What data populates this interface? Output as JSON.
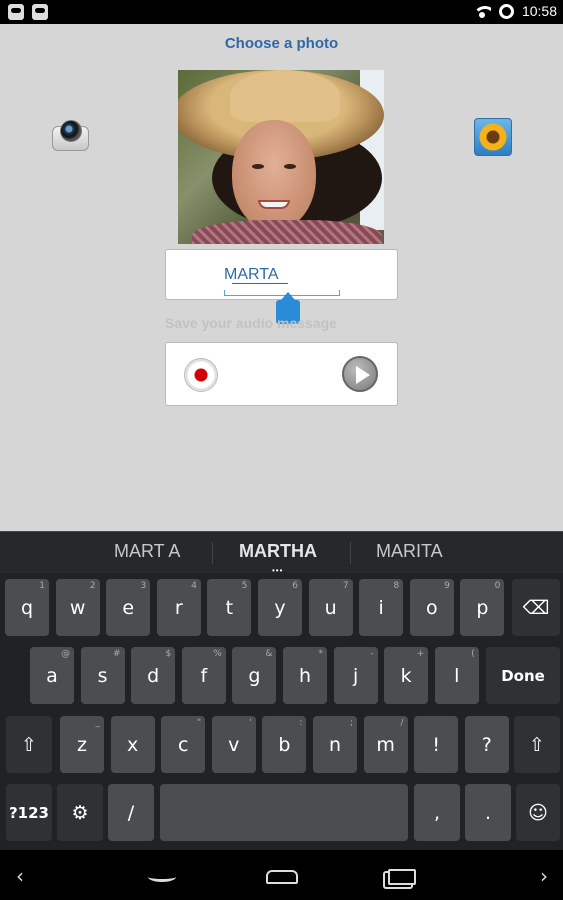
{
  "status_bar": {
    "time": "10:58"
  },
  "screen": {
    "title": "Choose a photo",
    "name_field": {
      "value": "MARTA"
    },
    "audio_hint": "Save your audio message"
  },
  "keyboard": {
    "suggestions": [
      "MART A",
      "MARTHA",
      "MARITA"
    ],
    "suggestion_more": "•••",
    "row1": [
      {
        "label": "q",
        "sub": "1"
      },
      {
        "label": "w",
        "sub": "2"
      },
      {
        "label": "e",
        "sub": "3"
      },
      {
        "label": "r",
        "sub": "4"
      },
      {
        "label": "t",
        "sub": "5"
      },
      {
        "label": "y",
        "sub": "6"
      },
      {
        "label": "u",
        "sub": "7"
      },
      {
        "label": "i",
        "sub": "8"
      },
      {
        "label": "o",
        "sub": "9"
      },
      {
        "label": "p",
        "sub": "0"
      }
    ],
    "row2": [
      {
        "label": "a",
        "sub": "@"
      },
      {
        "label": "s",
        "sub": "#"
      },
      {
        "label": "d",
        "sub": "$"
      },
      {
        "label": "f",
        "sub": "%"
      },
      {
        "label": "g",
        "sub": "&"
      },
      {
        "label": "h",
        "sub": "*"
      },
      {
        "label": "j",
        "sub": "-"
      },
      {
        "label": "k",
        "sub": "+"
      },
      {
        "label": "l",
        "sub": "("
      }
    ],
    "row3": [
      {
        "label": "z",
        "sub": "_"
      },
      {
        "label": "x",
        "sub": ""
      },
      {
        "label": "c",
        "sub": "\""
      },
      {
        "label": "v",
        "sub": "'"
      },
      {
        "label": "b",
        "sub": ":"
      },
      {
        "label": "n",
        "sub": ";"
      },
      {
        "label": "m",
        "sub": "/"
      },
      {
        "label": "!",
        "sub": ""
      },
      {
        "label": "?",
        "sub": ""
      }
    ],
    "done_label": "Done",
    "symbols_label": "?123",
    "settings_label": "⚙",
    "slash_label": "/",
    "comma_label": ",",
    "period_label": ".",
    "emoji_label": "☺",
    "shift_label": "⇧",
    "delete_label": "⌫"
  },
  "icons": {
    "camera": "camera-icon",
    "gallery": "gallery-icon",
    "record": "record-icon",
    "play": "play-icon"
  },
  "colors": {
    "title": "#2f68a8",
    "accent": "#2a8bd6",
    "record": "#d40000"
  }
}
